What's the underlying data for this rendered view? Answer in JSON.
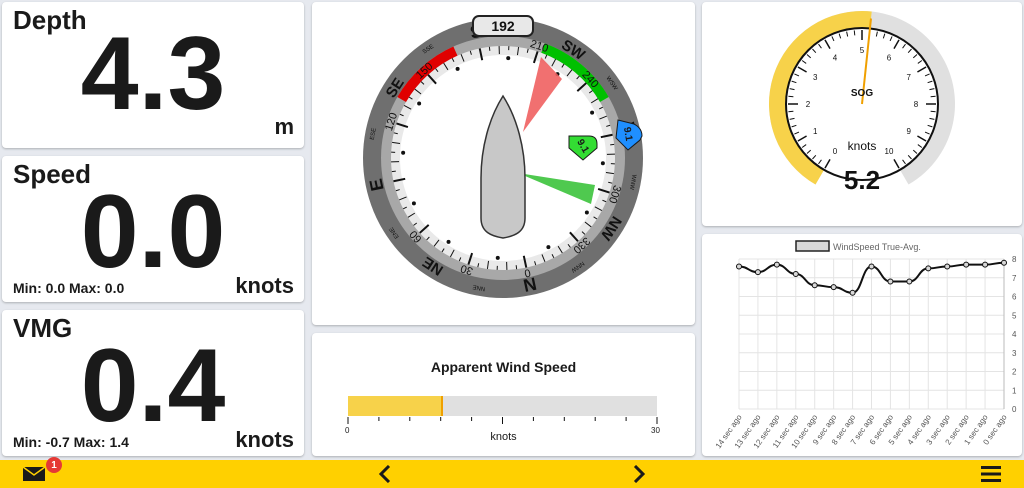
{
  "depth": {
    "label": "Depth",
    "value": "4.3",
    "unit": "m"
  },
  "speed": {
    "label": "Speed",
    "value": "0.0",
    "unit": "knots",
    "minmax": "Min: 0.0 Max: 0.0"
  },
  "vmg": {
    "label": "VMG",
    "value": "0.4",
    "unit": "knots",
    "minmax": "Min: -0.7 Max: 1.4"
  },
  "compass": {
    "heading_readout": "192",
    "apparent_wind_badge": "9.1",
    "true_wind_badge": "9.1",
    "cardinals": [
      "S",
      "SW",
      "W",
      "NW",
      "N",
      "NE",
      "E",
      "SE"
    ],
    "degree_labels": [
      "150",
      "210",
      "240",
      "300",
      "330",
      "0",
      "30",
      "60",
      "120"
    ],
    "intercardinals": [
      "SSW",
      "WSW",
      "WNW",
      "NNW",
      "NNE",
      "ENE",
      "ESE",
      "SSE"
    ]
  },
  "apparent_wind": {
    "title": "Apparent Wind Speed",
    "unit": "knots",
    "min": "0",
    "max": "30",
    "value": 9.1,
    "range_max": 30
  },
  "sog": {
    "label": "SOG",
    "unit": "knots",
    "value": "5.2",
    "ticks": [
      "0",
      "1",
      "2",
      "3",
      "4",
      "5",
      "6",
      "7",
      "8",
      "9",
      "10"
    ],
    "needle_value": 5.2
  },
  "chart_data": {
    "type": "line",
    "legend": "WindSpeed True-Avg.",
    "x": [
      "14 sec ago",
      "13 sec ago",
      "12 sec ago",
      "11 sec ago",
      "10 sec ago",
      "9 sec ago",
      "8 sec ago",
      "7 sec ago",
      "6 sec ago",
      "5 sec ago",
      "4 sec ago",
      "3 sec ago",
      "2 sec ago",
      "1 sec ago",
      "0 sec ago"
    ],
    "values": [
      7.6,
      7.3,
      7.7,
      7.2,
      6.6,
      6.5,
      6.2,
      7.6,
      6.8,
      6.8,
      7.5,
      7.6,
      7.7,
      7.7,
      7.8
    ],
    "yticks": [
      "0",
      "1",
      "2",
      "3",
      "4",
      "5",
      "6",
      "7",
      "8"
    ],
    "ylim": [
      0,
      8
    ],
    "grid": true,
    "legend_position": "top"
  },
  "footer": {
    "notifications_count": "1"
  },
  "colors": {
    "accent": "#ffd000",
    "port": "#e00000",
    "starboard": "#00c000",
    "gauge_fill": "#f7d24a"
  }
}
